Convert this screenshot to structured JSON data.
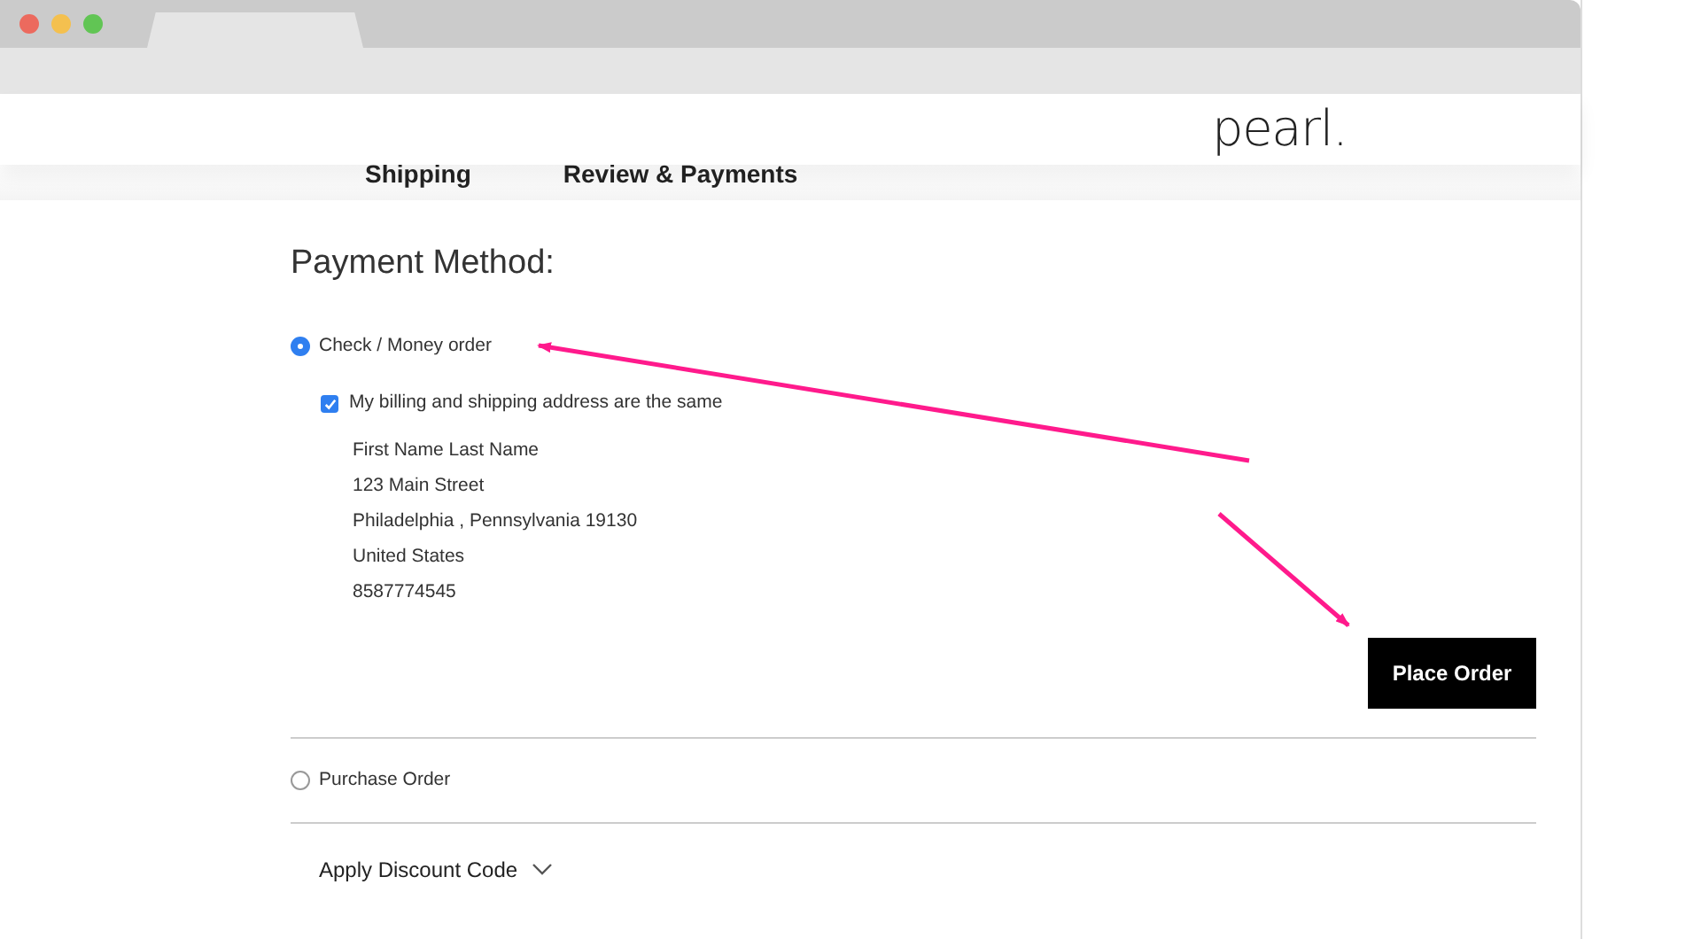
{
  "header": {
    "logo": "pearl."
  },
  "steps": [
    {
      "label": "Shipping"
    },
    {
      "label": "Review & Payments"
    }
  ],
  "heading": "Payment Method:",
  "methods": [
    {
      "label": "Check / Money order",
      "selected": true
    },
    {
      "label": "Purchase Order",
      "selected": false
    }
  ],
  "same_address": {
    "label": "My billing and shipping address are the same",
    "checked": true
  },
  "address": [
    "First Name Last Name",
    "123 Main Street",
    "Philadelphia , Pennsylvania 19130",
    "United States",
    "8587774545"
  ],
  "place_order": "Place Order",
  "discount": {
    "label": "Apply Discount Code",
    "expanded": false
  }
}
